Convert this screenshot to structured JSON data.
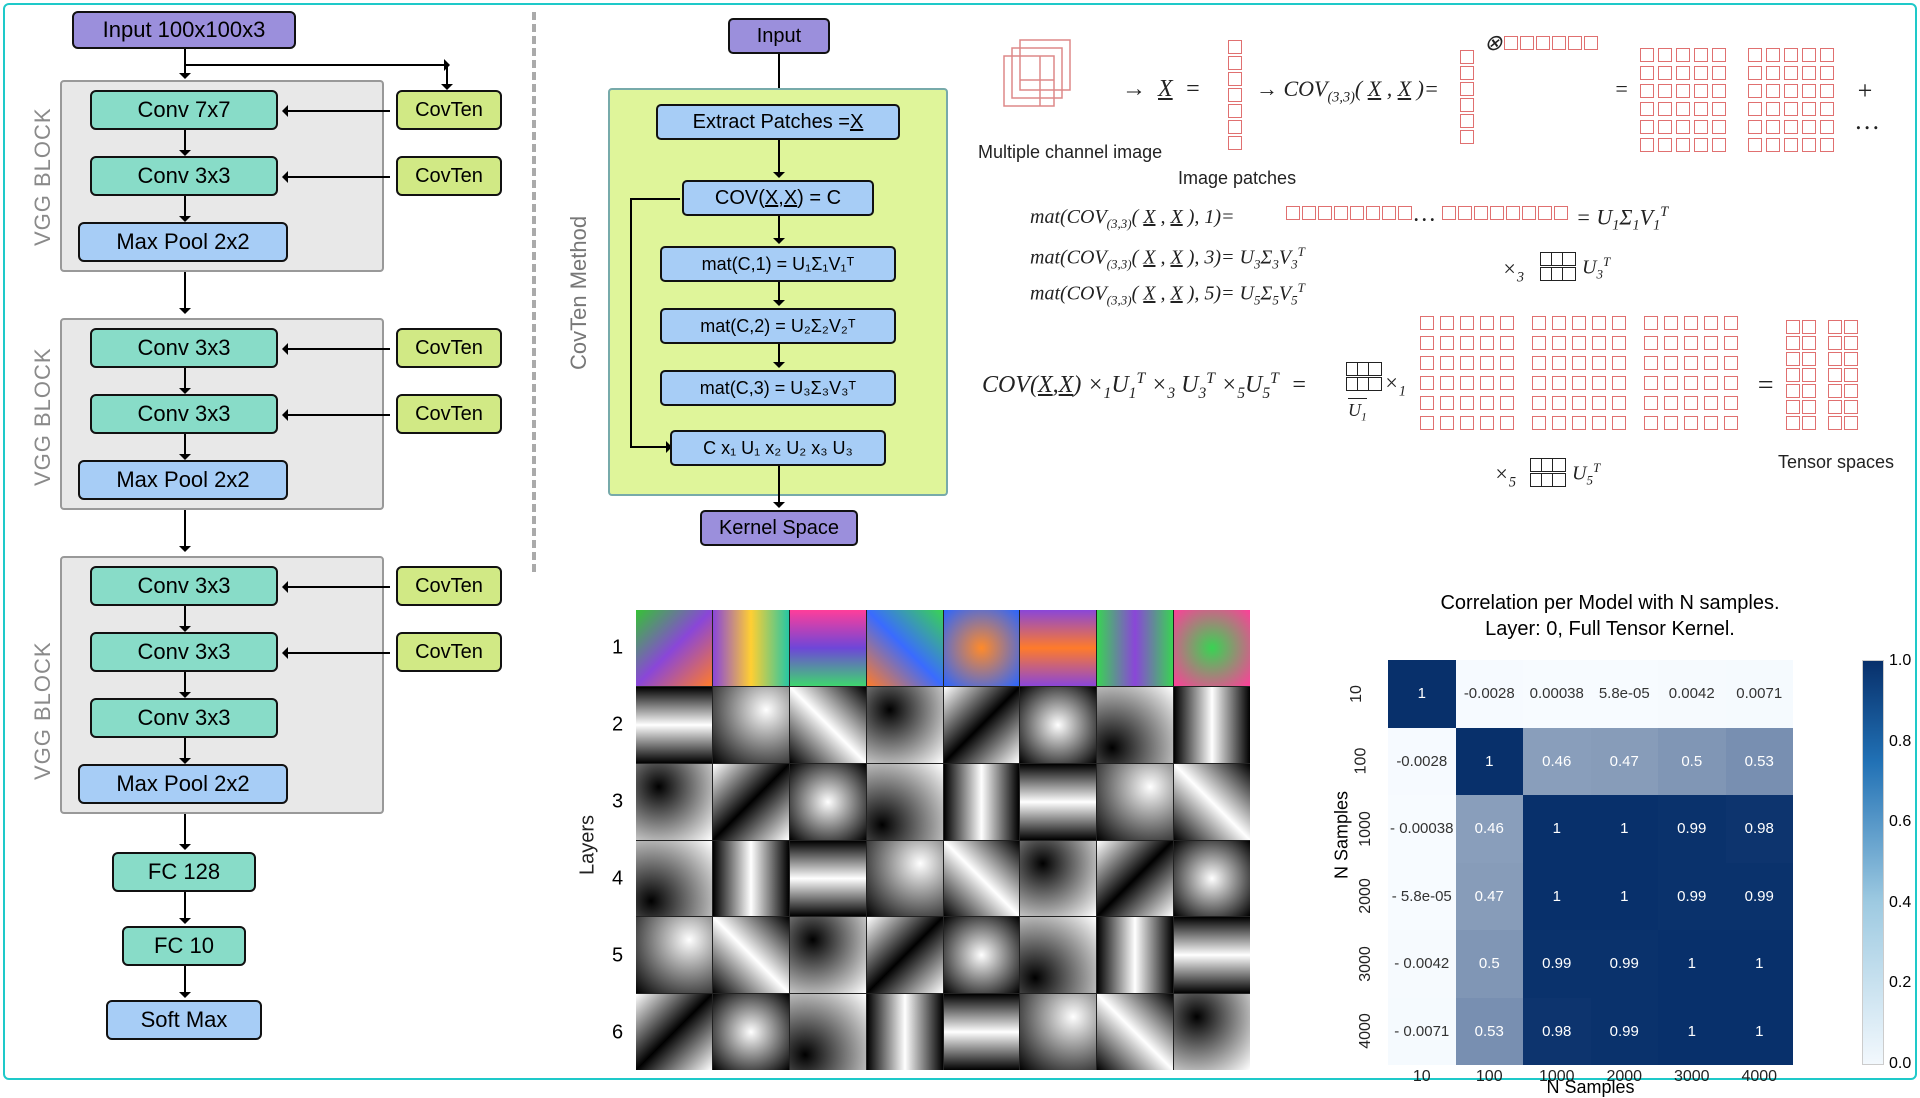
{
  "left": {
    "block_label": "VGG BLOCK",
    "input": "Input 100x100x3",
    "conv7": "Conv 7x7",
    "conv3": "Conv 3x3",
    "pool": "Max Pool 2x2",
    "covten": "CovTen",
    "fc128": "FC 128",
    "fc10": "FC 10",
    "softmax": "Soft Max"
  },
  "method": {
    "label": "CovTen Method",
    "input": "Input",
    "extract": "Extract Patches = ",
    "extract_x": "X",
    "cov_pre": "COV(",
    "cov_mid": "X",
    "cov_post": ") = C",
    "mat1": "mat(C,1) = U₁Σ₁V₁ᵀ",
    "mat2": "mat(C,2) = U₂Σ₂V₂ᵀ",
    "mat3": "mat(C,3) = U₃Σ₃V₃ᵀ",
    "final": "C x₁ U₁ x₂ U₂ x₃ U₃",
    "kernel_space": "Kernel Space"
  },
  "math": {
    "multi_channel": "Multiple channel image",
    "image_patches": "Image patches",
    "cov_expr_pre": "→  COV₍₃,₃₎( ",
    "cov_expr_mid": "X",
    "cov_expr_sep": " , ",
    "cov_expr_post": " )=",
    "plus_dots": "+ …",
    "mat1_pre": "mat(COV₍₃,₃₎( ",
    "mat1_post": " ), 1)=",
    "mat1_rhs": "= U₁Σ₁V₁ᵀ",
    "mat3_line": "mat(COV₍₃,₃₎( X , X ), 3)= U₃Σ₃V₃ᵀ",
    "mat5_line": "mat(COV₍₃,₃₎( X , X ), 5)= U₅Σ₅V₅ᵀ",
    "times3": "×₃",
    "u3t": "U₃ᵀ",
    "big_eq_lhs": "COV(X,X) ×₁U₁ᵀ ×₃ U₃ᵀ ×₅U₅ᵀ  =",
    "u1": "U₁",
    "times1": "×₁",
    "times5": "×₅",
    "u5t": "U₅ᵀ",
    "eq": "=",
    "tensor_spaces": "Tensor spaces",
    "dots": "…",
    "arrow_x": "→   X   =",
    "otimes": "⊗"
  },
  "patches": {
    "ylabel": "Layers",
    "rows": [
      "1",
      "2",
      "3",
      "4",
      "5",
      "6"
    ]
  },
  "chart_data": {
    "type": "heatmap",
    "title": "Correlation per Model with N samples.",
    "subtitle": "Layer: 0, Full Tensor Kernel.",
    "xlabel": "N Samples",
    "ylabel": "N Samples",
    "categories": [
      "10",
      "100",
      "1000",
      "2000",
      "3000",
      "4000"
    ],
    "matrix": [
      [
        1,
        -0.0028,
        0.00038,
        5.8e-05,
        0.0042,
        0.0071
      ],
      [
        -0.0028,
        1,
        0.46,
        0.47,
        0.5,
        0.53
      ],
      [
        -0.00038,
        0.46,
        1,
        1,
        0.99,
        0.98
      ],
      [
        -5.8e-05,
        0.47,
        1,
        1,
        0.99,
        0.99
      ],
      [
        -0.0042,
        0.5,
        0.99,
        0.99,
        1,
        1
      ],
      [
        -0.0071,
        0.53,
        0.98,
        0.99,
        1,
        1
      ]
    ],
    "colorbar_range": [
      0.0,
      1.0
    ],
    "colorbar_ticks": [
      "1.0",
      "0.8",
      "0.6",
      "0.4",
      "0.2",
      "0.0"
    ],
    "display": [
      [
        "1",
        "-0.0028",
        "0.00038",
        "5.8e-05",
        "0.0042",
        "0.0071"
      ],
      [
        "-0.0028",
        "1",
        "0.46",
        "0.47",
        "0.5",
        "0.53"
      ],
      [
        "- 0.00038",
        "0.46",
        "1",
        "1",
        "0.99",
        "0.98"
      ],
      [
        "- 5.8e-05",
        "0.47",
        "1",
        "1",
        "0.99",
        "0.99"
      ],
      [
        "- 0.0042",
        "0.5",
        "0.99",
        "0.99",
        "1",
        "1"
      ],
      [
        "- 0.0071",
        "0.53",
        "0.98",
        "0.99",
        "1",
        "1"
      ]
    ]
  }
}
